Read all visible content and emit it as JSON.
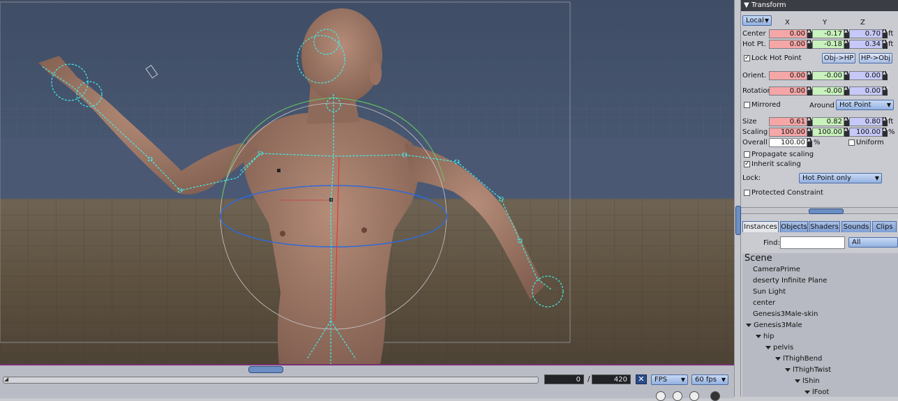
{
  "transform": {
    "header": "Transform",
    "space": "Local",
    "axes": [
      "X",
      "Y",
      "Z"
    ],
    "center": {
      "label": "Center",
      "x": "0.00",
      "y": "-0.17",
      "z": "0.70",
      "unit": "ft"
    },
    "hot_pt": {
      "label": "Hot Pt.",
      "x": "0.00",
      "y": "-0.18",
      "z": "0.34",
      "unit": "ft"
    },
    "lock_hot_point": {
      "label": "Lock Hot Point",
      "checked": true
    },
    "obj_hp_button": "Obj->HP",
    "hp_obj_button": "HP->Obj",
    "orient": {
      "label": "Orient.",
      "x": "0.00",
      "y": "-0.00",
      "z": "0.00"
    },
    "rotation": {
      "label": "Rotation",
      "x": "0.00",
      "y": "-0.00",
      "z": "0.00"
    },
    "mirrored": {
      "label": "Mirrored",
      "checked": false
    },
    "around_label": "Around",
    "around_value": "Hot Point",
    "size": {
      "label": "Size",
      "x": "0.61",
      "y": "0.82",
      "z": "0.80",
      "unit": "ft"
    },
    "scaling": {
      "label": "Scaling",
      "x": "100.00",
      "y": "100.00",
      "z": "100.00",
      "unit": "%"
    },
    "overall": {
      "label": "Overall",
      "value": "100.00",
      "unit": "%"
    },
    "uniform": {
      "label": "Uniform",
      "checked": false
    },
    "propagate_scaling": {
      "label": "Propagate scaling",
      "checked": false
    },
    "inherit_scaling": {
      "label": "Inherit scaling",
      "checked": true
    },
    "lock_label": "Lock:",
    "lock_value": "Hot Point only",
    "protected_constraint": {
      "label": "Protected Constraint",
      "checked": false
    }
  },
  "browser": {
    "tabs": [
      "Instances",
      "Objects",
      "Shaders",
      "Sounds",
      "Clips"
    ],
    "active_tab": "Instances",
    "find_label": "Find:",
    "find_value": "",
    "filter_value": "All",
    "scene_label": "Scene",
    "items": [
      {
        "label": "CameraPrime"
      },
      {
        "label": "deserty Infinite Plane"
      },
      {
        "label": "Sun Light"
      },
      {
        "label": "center"
      },
      {
        "label": "Genesis3Male-skin"
      },
      {
        "label": "Genesis3Male"
      },
      {
        "label": "hip"
      },
      {
        "label": "pelvis"
      },
      {
        "label": "lThighBend"
      },
      {
        "label": "lThighTwist"
      },
      {
        "label": "lShin"
      },
      {
        "label": "lFoot"
      }
    ]
  },
  "timeline": {
    "current_frame": "0",
    "separator": "/",
    "total_frames": "420",
    "rate_mode": "FPS",
    "rate_value": "60 fps"
  }
}
